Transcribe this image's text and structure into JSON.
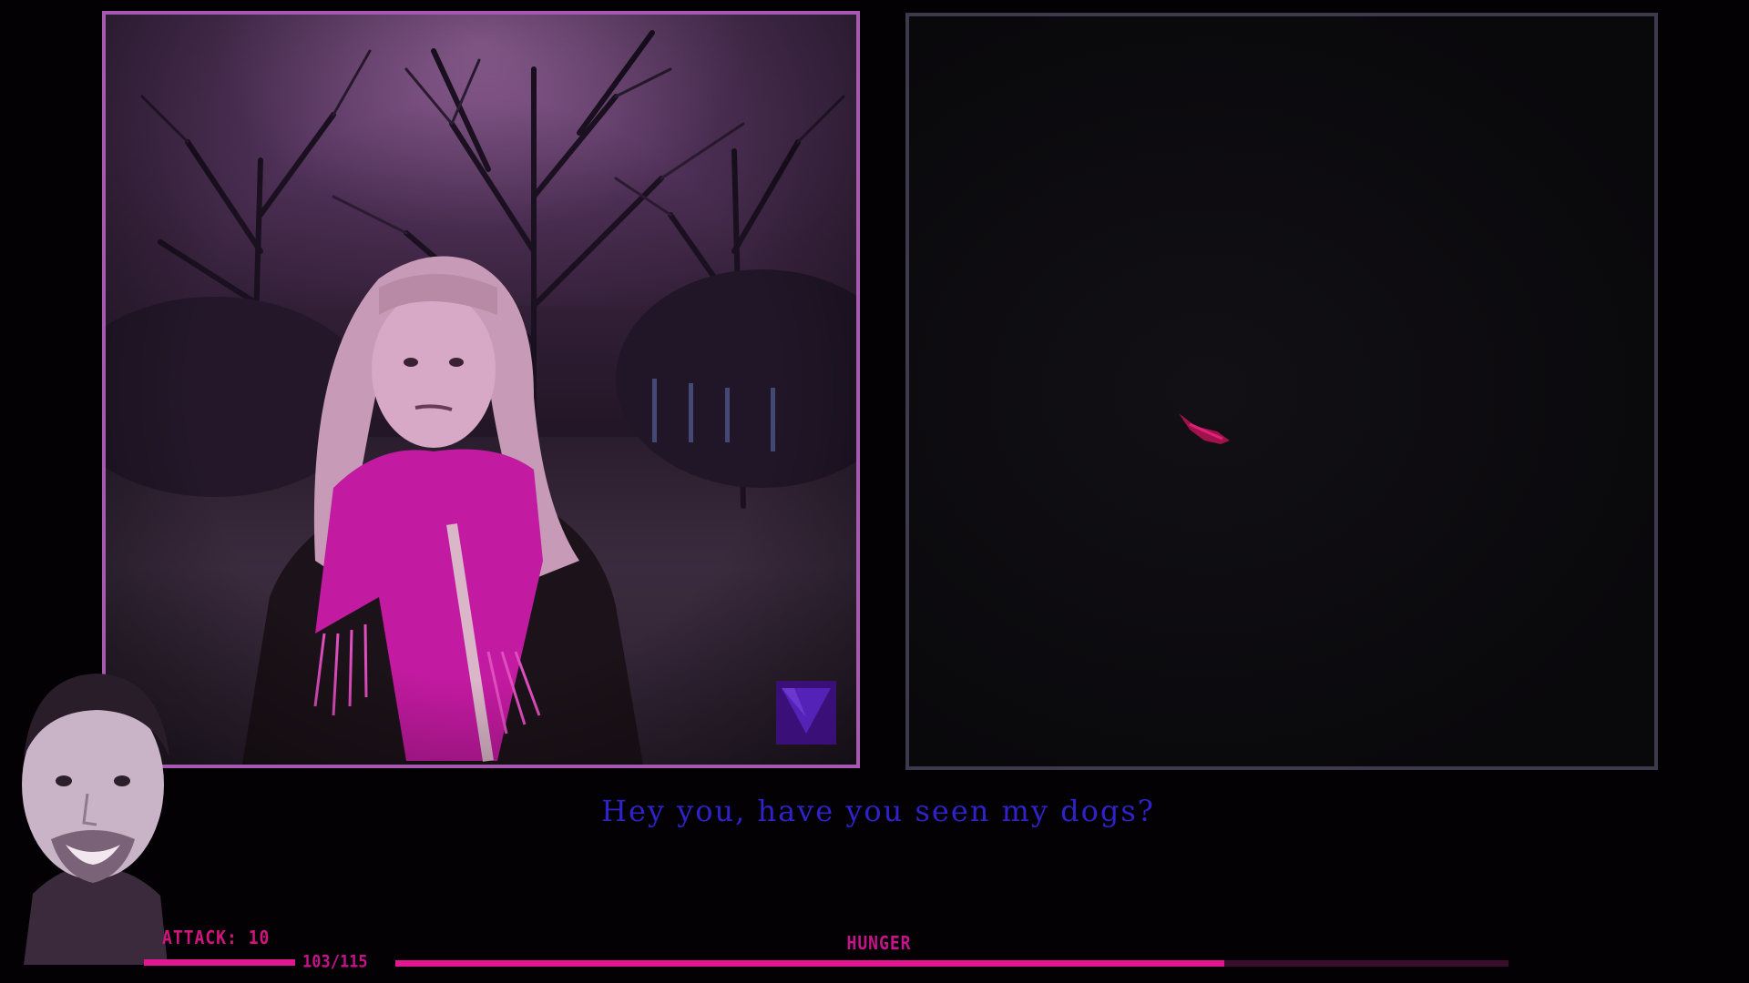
{
  "dialogue": {
    "text": "Hey you, have you seen my dogs?"
  },
  "hud": {
    "attack_label": "ATTACK: 10",
    "health_text": "103/115",
    "health_fraction": 0.896,
    "hunger_label": "HUNGER",
    "hunger_fraction": 0.745
  },
  "colors": {
    "accent": "#e01791",
    "dialogue_text": "#2e22c8",
    "scene_border": "#a55ab0",
    "next_indicator": "#3a0f78"
  },
  "icons": {
    "next": "triangle-down-icon"
  }
}
